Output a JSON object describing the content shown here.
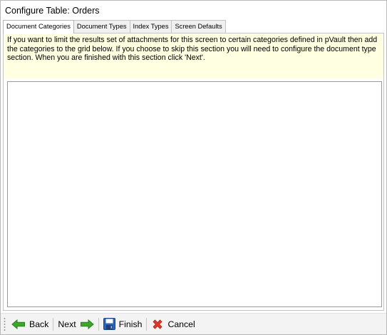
{
  "window": {
    "title": "Configure Table: Orders"
  },
  "tabs": [
    {
      "label": "Document Categories",
      "active": true
    },
    {
      "label": "Document Types",
      "active": false
    },
    {
      "label": "Index Types",
      "active": false
    },
    {
      "label": "Screen Defaults",
      "active": false
    }
  ],
  "info": {
    "text": "If you want to limit the results set of attachments for this screen to certain categories defined in pVault then add the categories to the grid below. If  you choose to skip this section you will need to configure the document type section.  When you are finished with this section click 'Next'.",
    "background_color": "#ffffe1"
  },
  "toolbar": {
    "back_label": "Back",
    "next_label": "Next",
    "finish_label": "Finish",
    "cancel_label": "Cancel",
    "icons": {
      "back": "green-left-arrow-icon",
      "next": "green-right-arrow-icon",
      "finish": "floppy-disk-icon",
      "cancel": "red-x-icon"
    },
    "colors": {
      "arrow": "#3ea52d",
      "disk": "#2a63b8",
      "cancel": "#e0392b"
    }
  }
}
